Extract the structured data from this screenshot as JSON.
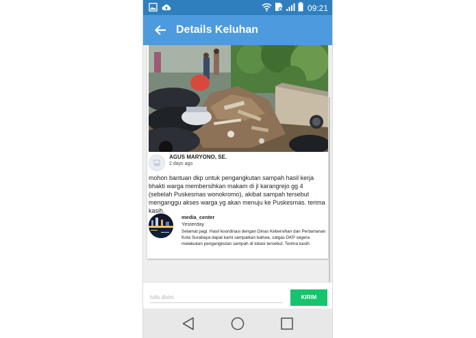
{
  "status_bar": {
    "time": "09:21",
    "icons": [
      "image-icon",
      "cloud-upload-icon",
      "wifi-icon",
      "no-sim-icon",
      "signal-icon",
      "battery-icon"
    ]
  },
  "app_bar": {
    "title": "Details Keluhan",
    "back_icon": "arrow-left-icon"
  },
  "complaint": {
    "author": "AGUS MARYONO, SE.",
    "time": "2 days ago",
    "text": "mohon bantuan dkp untuk pengangkutan sampah hasil kerja bhakti warga membersihkan makam di jl karangrejo gg 4 (sebelah Puskesmas wonokromo), akibat sampah tersebut menganggu akses warga yg akan menuju ke Puskesmas. terima kasih."
  },
  "reply": {
    "author": "media_center",
    "time": "Yesterday",
    "text": "Selamat pagi. Hasil koordinasi dengan Dinas Kebersihan dan Pertamanan Kota Surabaya dapat kami sampaikan bahwa, satgas DKP segera melakukan pengangkutan sampah di lokasi tersebut. Terima kasih."
  },
  "comment_box": {
    "placeholder": "tulis disini",
    "send_label": "KIRIM"
  },
  "colors": {
    "status_bar": "#2f7fbf",
    "app_bar": "#4d9bde",
    "send_button": "#16c46d"
  }
}
